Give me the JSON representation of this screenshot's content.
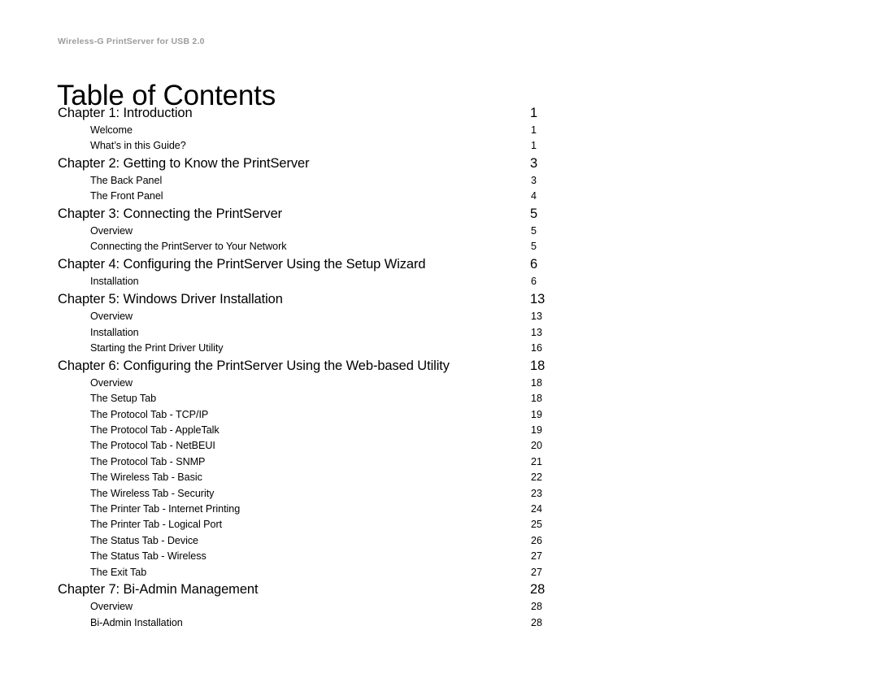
{
  "document": {
    "running_header": "Wireless-G PrintServer for USB 2.0",
    "title": "Table of Contents"
  },
  "toc": {
    "entries": [
      {
        "level": "chapter",
        "label": "Chapter 1: Introduction",
        "page": "1"
      },
      {
        "level": "section",
        "label": "Welcome",
        "page": "1"
      },
      {
        "level": "section",
        "label": "What’s in this Guide?",
        "page": "1"
      },
      {
        "level": "chapter",
        "label": "Chapter 2: Getting to Know the PrintServer",
        "page": "3"
      },
      {
        "level": "section",
        "label": "The Back Panel",
        "page": "3"
      },
      {
        "level": "section",
        "label": "The Front Panel",
        "page": "4"
      },
      {
        "level": "chapter",
        "label": "Chapter 3: Connecting the PrintServer",
        "page": "5"
      },
      {
        "level": "section",
        "label": "Overview",
        "page": "5"
      },
      {
        "level": "section",
        "label": "Connecting the PrintServer to Your Network",
        "page": "5"
      },
      {
        "level": "chapter",
        "label": "Chapter 4: Configuring the PrintServer Using the Setup Wizard",
        "page": "6"
      },
      {
        "level": "section",
        "label": "Installation",
        "page": "6"
      },
      {
        "level": "chapter",
        "label": "Chapter 5: Windows Driver Installation",
        "page": "13"
      },
      {
        "level": "section",
        "label": "Overview",
        "page": "13"
      },
      {
        "level": "section",
        "label": "Installation",
        "page": "13"
      },
      {
        "level": "section",
        "label": "Starting the Print Driver Utility",
        "page": "16"
      },
      {
        "level": "chapter",
        "label": "Chapter 6: Configuring the PrintServer Using the Web-based Utility",
        "page": "18"
      },
      {
        "level": "section",
        "label": "Overview",
        "page": "18"
      },
      {
        "level": "section",
        "label": "The Setup Tab",
        "page": "18"
      },
      {
        "level": "section",
        "label": "The Protocol Tab - TCP/IP",
        "page": "19"
      },
      {
        "level": "section",
        "label": "The Protocol Tab - AppleTalk",
        "page": "19"
      },
      {
        "level": "section",
        "label": "The Protocol Tab - NetBEUI",
        "page": "20"
      },
      {
        "level": "section",
        "label": "The Protocol Tab - SNMP",
        "page": "21"
      },
      {
        "level": "section",
        "label": "The Wireless Tab - Basic",
        "page": "22"
      },
      {
        "level": "section",
        "label": "The Wireless Tab - Security",
        "page": "23"
      },
      {
        "level": "section",
        "label": "The Printer Tab - Internet Printing",
        "page": "24"
      },
      {
        "level": "section",
        "label": "The Printer Tab - Logical Port",
        "page": "25"
      },
      {
        "level": "section",
        "label": "The Status Tab - Device",
        "page": "26"
      },
      {
        "level": "section",
        "label": "The Status Tab - Wireless",
        "page": "27"
      },
      {
        "level": "section",
        "label": "The Exit Tab",
        "page": "27"
      },
      {
        "level": "chapter",
        "label": "Chapter 7: Bi-Admin Management",
        "page": "28"
      },
      {
        "level": "section",
        "label": "Overview",
        "page": "28"
      },
      {
        "level": "section",
        "label": "Bi-Admin Installation",
        "page": "28"
      }
    ]
  }
}
